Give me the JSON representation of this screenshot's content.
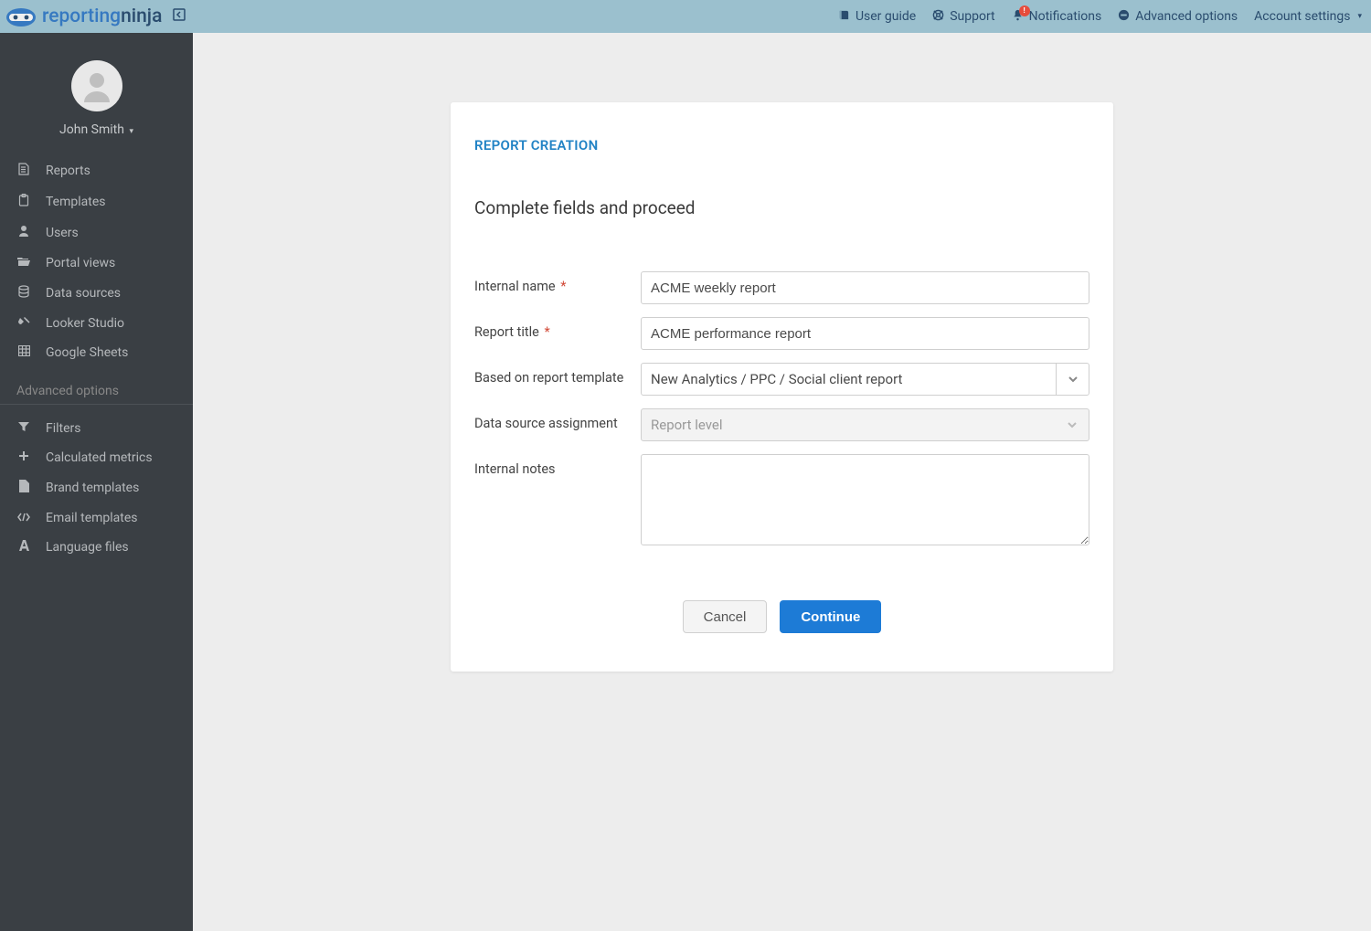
{
  "brand": {
    "word1": "reporting",
    "word2": "ninja"
  },
  "topbar": {
    "user_guide": "User guide",
    "support": "Support",
    "notifications": "Notifications",
    "advanced_options": "Advanced options",
    "account_settings": "Account settings",
    "notif_badge": "!"
  },
  "user": {
    "name": "John Smith"
  },
  "sidebar": {
    "items": [
      {
        "label": "Reports"
      },
      {
        "label": "Templates"
      },
      {
        "label": "Users"
      },
      {
        "label": "Portal views"
      },
      {
        "label": "Data sources"
      },
      {
        "label": "Looker Studio"
      },
      {
        "label": "Google Sheets"
      }
    ],
    "section_label": "Advanced options",
    "advanced": [
      {
        "label": "Filters"
      },
      {
        "label": "Calculated metrics"
      },
      {
        "label": "Brand templates"
      },
      {
        "label": "Email templates"
      },
      {
        "label": "Language files"
      }
    ]
  },
  "card": {
    "title": "REPORT CREATION",
    "subtitle": "Complete fields and proceed",
    "labels": {
      "internal_name": "Internal name",
      "report_title": "Report title",
      "template": "Based on report template",
      "data_source": "Data source assignment",
      "notes": "Internal notes"
    },
    "values": {
      "internal_name": "ACME weekly report",
      "report_title": "ACME performance report",
      "template": "New Analytics / PPC / Social client report",
      "data_source": "Report level",
      "notes": ""
    },
    "buttons": {
      "cancel": "Cancel",
      "continue": "Continue"
    }
  }
}
